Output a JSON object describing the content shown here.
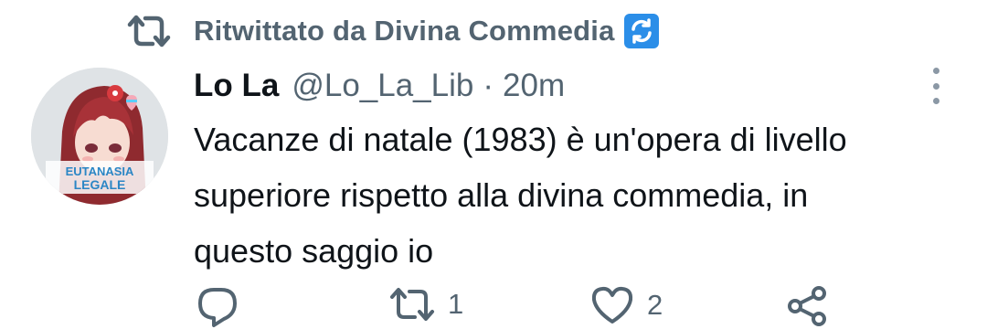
{
  "retweet_banner": {
    "text": "Ritwittato da Divina Commedia",
    "badge_icon": "refresh-icon"
  },
  "tweet": {
    "author_name": "Lo La",
    "handle": "@Lo_La_Lib",
    "separator": "·",
    "time": "20m",
    "lines": [
      "Vacanze di natale (1983) è un'opera di livello",
      "superiore rispetto alla divina commedia, in",
      "questo saggio io"
    ],
    "avatar_text": {
      "top": "EUTANASIA",
      "bottom": "LEGALE"
    }
  },
  "actions": {
    "reply": {
      "icon": "reply-icon"
    },
    "retweet": {
      "icon": "retweet-icon",
      "count": "1"
    },
    "like": {
      "icon": "heart-icon",
      "count": "2"
    },
    "share": {
      "icon": "share-icon"
    }
  },
  "colors": {
    "secondary": "#536471",
    "text": "#0f1419",
    "badge": "#2b8ee8"
  }
}
